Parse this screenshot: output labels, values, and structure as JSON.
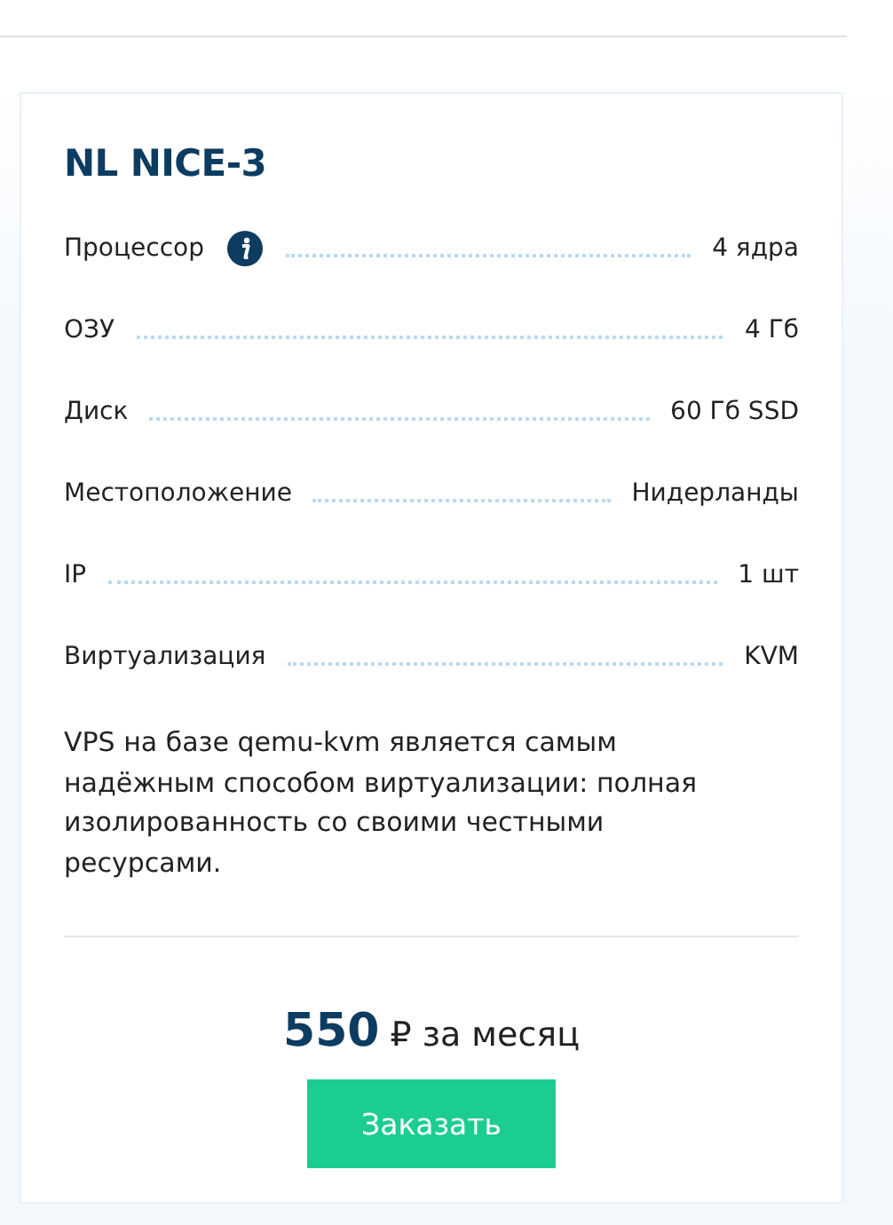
{
  "plan": {
    "title": "NL NICE-3",
    "specs": [
      {
        "label": "Процессор",
        "info": true,
        "value": "4 ядра"
      },
      {
        "label": "ОЗУ",
        "info": false,
        "value": "4 Гб"
      },
      {
        "label": "Диск",
        "info": false,
        "value": "60 Гб SSD"
      },
      {
        "label": "Местоположение",
        "info": false,
        "value": "Нидерланды"
      },
      {
        "label": "IP",
        "info": false,
        "value": "1 шт"
      },
      {
        "label": "Виртуализация",
        "info": false,
        "value": "KVM"
      }
    ],
    "description": "VPS на базе qemu-kvm является самым надёжным способом виртуализации: полная изолированность со своими честными ресурсами.",
    "price": {
      "amount": "550",
      "period": "₽ за месяц"
    },
    "order_button": "Заказать"
  }
}
